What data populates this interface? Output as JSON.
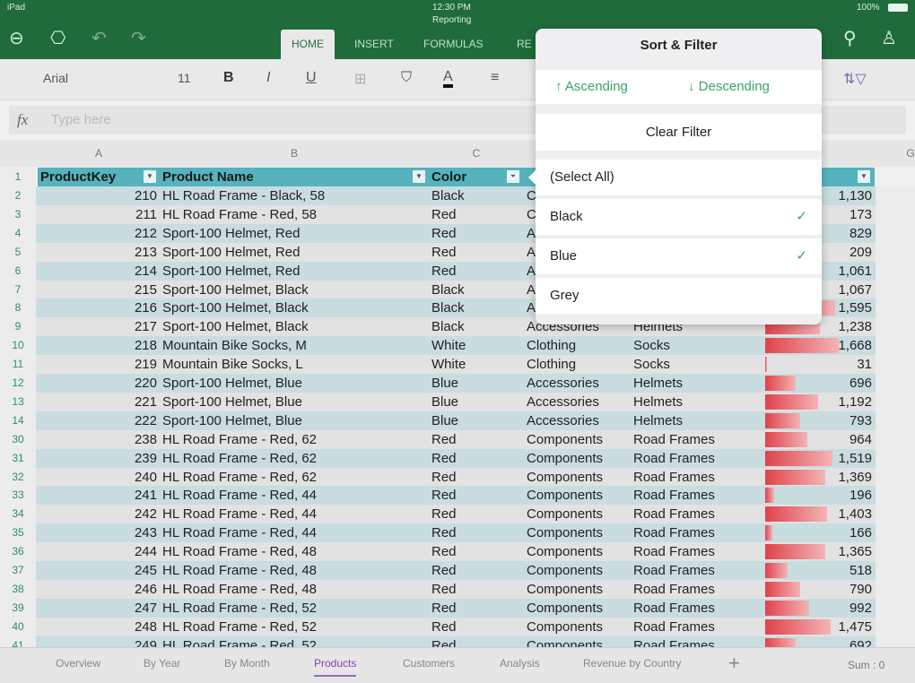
{
  "status": {
    "device": "iPad",
    "time": "12:30 PM",
    "doc_title": "Reporting",
    "battery": "100%"
  },
  "ribbon_tabs": [
    {
      "label": "HOME",
      "active": true
    },
    {
      "label": "INSERT"
    },
    {
      "label": "FORMULAS"
    },
    {
      "label": "RE"
    }
  ],
  "toolbar": {
    "font": "Arial",
    "size": "11",
    "bold": "B",
    "italic": "I",
    "underline": "U",
    "font_color": "A"
  },
  "formula": {
    "fx": "fx",
    "placeholder": "Type here"
  },
  "columns": [
    "A",
    "B",
    "C",
    "G"
  ],
  "header": {
    "row": "1",
    "product_key": "ProductKey",
    "product_name": "Product Name",
    "color": "Color"
  },
  "rows": [
    {
      "n": "2",
      "key": "210",
      "name": "HL Road Frame - Black, 58",
      "color": "Black",
      "cat": "C",
      "sub": "",
      "val": "1,130",
      "v": 1130
    },
    {
      "n": "3",
      "key": "211",
      "name": "HL Road Frame - Red, 58",
      "color": "Red",
      "cat": "C",
      "sub": "",
      "val": "173",
      "v": 173
    },
    {
      "n": "4",
      "key": "212",
      "name": "Sport-100 Helmet, Red",
      "color": "Red",
      "cat": "A",
      "sub": "",
      "val": "829",
      "v": 829
    },
    {
      "n": "5",
      "key": "213",
      "name": "Sport-100 Helmet, Red",
      "color": "Red",
      "cat": "A",
      "sub": "",
      "val": "209",
      "v": 209
    },
    {
      "n": "6",
      "key": "214",
      "name": "Sport-100 Helmet, Red",
      "color": "Red",
      "cat": "A",
      "sub": "",
      "val": "1,061",
      "v": 1061
    },
    {
      "n": "7",
      "key": "215",
      "name": "Sport-100 Helmet, Black",
      "color": "Black",
      "cat": "A",
      "sub": "",
      "val": "1,067",
      "v": 1067
    },
    {
      "n": "8",
      "key": "216",
      "name": "Sport-100 Helmet, Black",
      "color": "Black",
      "cat": "A",
      "sub": "",
      "val": "1,595",
      "v": 1595
    },
    {
      "n": "9",
      "key": "217",
      "name": "Sport-100 Helmet, Black",
      "color": "Black",
      "cat": "Accessories",
      "sub": "Helmets",
      "val": "1,238",
      "v": 1238
    },
    {
      "n": "10",
      "key": "218",
      "name": "Mountain Bike Socks, M",
      "color": "White",
      "cat": "Clothing",
      "sub": "Socks",
      "val": "1,668",
      "v": 1668
    },
    {
      "n": "11",
      "key": "219",
      "name": "Mountain Bike Socks, L",
      "color": "White",
      "cat": "Clothing",
      "sub": "Socks",
      "val": "31",
      "v": 31
    },
    {
      "n": "12",
      "key": "220",
      "name": "Sport-100 Helmet, Blue",
      "color": "Blue",
      "cat": "Accessories",
      "sub": "Helmets",
      "val": "696",
      "v": 696
    },
    {
      "n": "13",
      "key": "221",
      "name": "Sport-100 Helmet, Blue",
      "color": "Blue",
      "cat": "Accessories",
      "sub": "Helmets",
      "val": "1,192",
      "v": 1192
    },
    {
      "n": "14",
      "key": "222",
      "name": "Sport-100 Helmet, Blue",
      "color": "Blue",
      "cat": "Accessories",
      "sub": "Helmets",
      "val": "793",
      "v": 793
    },
    {
      "n": "30",
      "key": "238",
      "name": "HL Road Frame - Red, 62",
      "color": "Red",
      "cat": "Components",
      "sub": "Road Frames",
      "val": "964",
      "v": 964
    },
    {
      "n": "31",
      "key": "239",
      "name": "HL Road Frame - Red, 62",
      "color": "Red",
      "cat": "Components",
      "sub": "Road Frames",
      "val": "1,519",
      "v": 1519
    },
    {
      "n": "32",
      "key": "240",
      "name": "HL Road Frame - Red, 62",
      "color": "Red",
      "cat": "Components",
      "sub": "Road Frames",
      "val": "1,369",
      "v": 1369
    },
    {
      "n": "33",
      "key": "241",
      "name": "HL Road Frame - Red, 44",
      "color": "Red",
      "cat": "Components",
      "sub": "Road Frames",
      "val": "196",
      "v": 196
    },
    {
      "n": "34",
      "key": "242",
      "name": "HL Road Frame - Red, 44",
      "color": "Red",
      "cat": "Components",
      "sub": "Road Frames",
      "val": "1,403",
      "v": 1403
    },
    {
      "n": "35",
      "key": "243",
      "name": "HL Road Frame - Red, 44",
      "color": "Red",
      "cat": "Components",
      "sub": "Road Frames",
      "val": "166",
      "v": 166
    },
    {
      "n": "36",
      "key": "244",
      "name": "HL Road Frame - Red, 48",
      "color": "Red",
      "cat": "Components",
      "sub": "Road Frames",
      "val": "1,365",
      "v": 1365
    },
    {
      "n": "37",
      "key": "245",
      "name": "HL Road Frame - Red, 48",
      "color": "Red",
      "cat": "Components",
      "sub": "Road Frames",
      "val": "518",
      "v": 518
    },
    {
      "n": "38",
      "key": "246",
      "name": "HL Road Frame - Red, 48",
      "color": "Red",
      "cat": "Components",
      "sub": "Road Frames",
      "val": "790",
      "v": 790
    },
    {
      "n": "39",
      "key": "247",
      "name": "HL Road Frame - Red, 52",
      "color": "Red",
      "cat": "Components",
      "sub": "Road Frames",
      "val": "992",
      "v": 992
    },
    {
      "n": "40",
      "key": "248",
      "name": "HL Road Frame - Red, 52",
      "color": "Red",
      "cat": "Components",
      "sub": "Road Frames",
      "val": "1,475",
      "v": 1475
    },
    {
      "n": "41",
      "key": "249",
      "name": "HL Road Frame - Red, 52",
      "color": "Red",
      "cat": "Components",
      "sub": "Road Frames",
      "val": "692",
      "v": 692
    }
  ],
  "popup": {
    "title": "Sort & Filter",
    "ascending": "Ascending",
    "descending": "Descending",
    "clear": "Clear Filter",
    "items": [
      {
        "label": "(Select All)",
        "checked": false
      },
      {
        "label": "Black",
        "checked": true
      },
      {
        "label": "Blue",
        "checked": true
      },
      {
        "label": "Grey",
        "checked": false
      }
    ]
  },
  "sheets": [
    {
      "label": "Overview"
    },
    {
      "label": "By Year"
    },
    {
      "label": "By Month"
    },
    {
      "label": "Products",
      "active": true
    },
    {
      "label": "Customers"
    },
    {
      "label": "Analysis"
    },
    {
      "label": "Revenue by Country"
    }
  ],
  "add_sheet": "+",
  "sum": "Sum : 0",
  "colors": {
    "accent": "#217346",
    "header": "#55b3bd",
    "stripe": "#c9dcdf",
    "bar": "#e0424a",
    "popup_action": "#3aa56a"
  }
}
